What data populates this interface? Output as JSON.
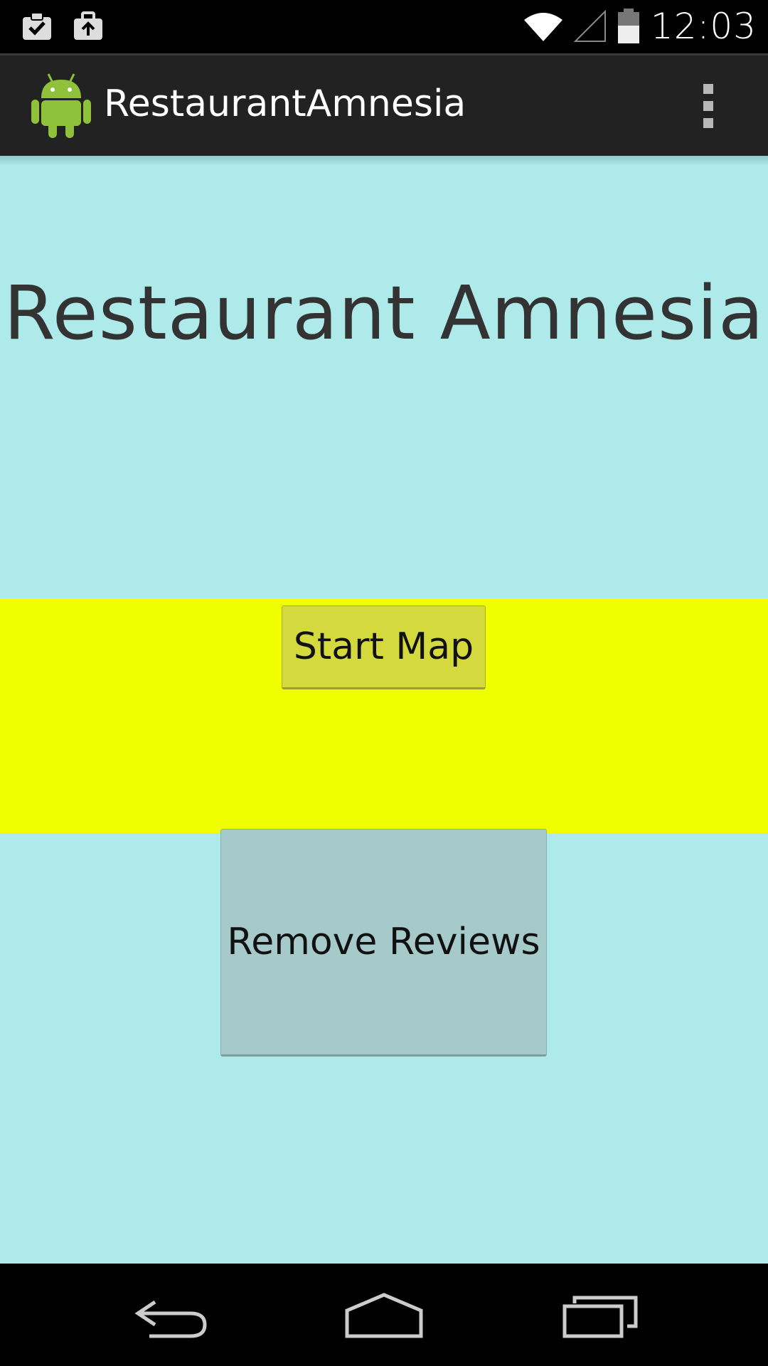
{
  "status_bar": {
    "time": "12:03",
    "icons": [
      "clipboard-check-icon",
      "briefcase-upload-icon",
      "wifi-icon",
      "signal-icon",
      "battery-icon"
    ]
  },
  "action_bar": {
    "title": "RestaurantAmnesia",
    "app_icon": "android-icon",
    "overflow_icon": "overflow-menu-icon"
  },
  "main": {
    "headline": "Restaurant Amnesia",
    "start_map_label": "Start Map",
    "remove_reviews_label": "Remove Reviews"
  },
  "nav_bar": {
    "icons": [
      "back-icon",
      "home-icon",
      "recents-icon"
    ]
  },
  "colors": {
    "background": "#aeeae9",
    "band": "#f0ff00",
    "start_button": "#d4da3d",
    "remove_button": "#a6caca",
    "action_bar": "#222222"
  }
}
